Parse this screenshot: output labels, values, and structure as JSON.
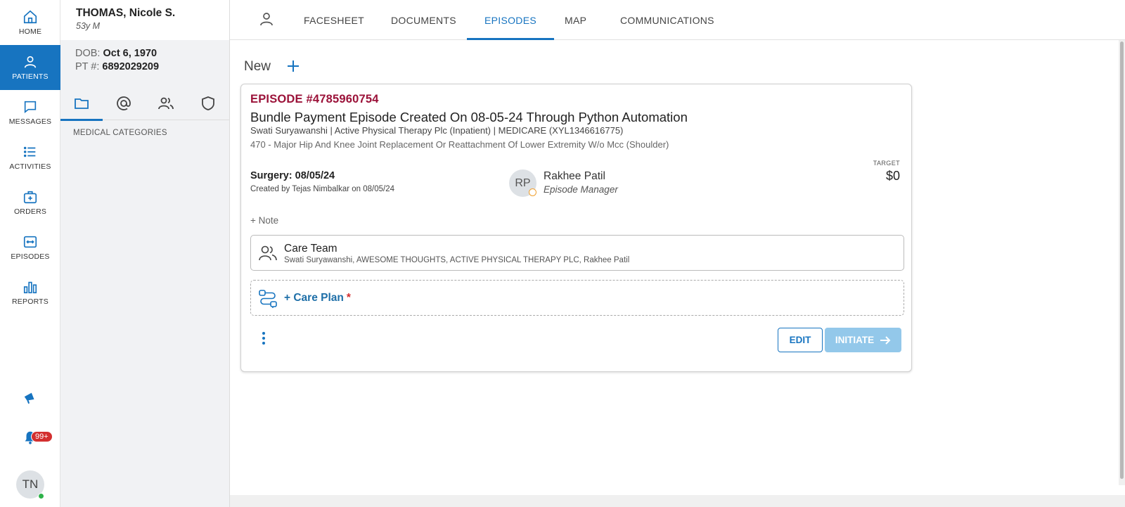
{
  "leftnav": {
    "items": [
      {
        "label": "HOME",
        "icon": "home-icon"
      },
      {
        "label": "PATIENTS",
        "icon": "person-icon"
      },
      {
        "label": "MESSAGES",
        "icon": "chat-icon"
      },
      {
        "label": "ACTIVITIES",
        "icon": "list-icon"
      },
      {
        "label": "ORDERS",
        "icon": "medical-bag-icon"
      },
      {
        "label": "EPISODES",
        "icon": "episode-icon"
      },
      {
        "label": "REPORTS",
        "icon": "bar-chart-icon"
      }
    ],
    "active": "PATIENTS",
    "notification_count": "99+",
    "user_initials": "TN"
  },
  "patient": {
    "name": "THOMAS, Nicole S.",
    "age_sex": "53y M",
    "dob_label": "DOB:",
    "dob": "Oct 6, 1970",
    "pt_label": "PT #:",
    "pt_number": "6892029209",
    "section_label": "MEDICAL CATEGORIES"
  },
  "tabs": [
    "FACESHEET",
    "DOCUMENTS",
    "EPISODES",
    "MAP",
    "COMMUNICATIONS"
  ],
  "active_tab": "EPISODES",
  "main": {
    "new_label": "New",
    "episode": {
      "id": "EPISODE #4785960754",
      "title": "Bundle Payment Episode Created On 08-05-24 Through Python Automation",
      "subtitle": "Swati Suryawanshi | Active Physical Therapy Plc (Inpatient) | MEDICARE (XYL1346616775)",
      "drg": "470 - Major Hip And Knee Joint Replacement Or Reattachment Of Lower Extremity W/o Mcc (Shoulder)",
      "surgery": "Surgery: 08/05/24",
      "created": "Created by Tejas Nimbalkar on 08/05/24",
      "manager_initials": "RP",
      "manager_name": "Rakhee Patil",
      "manager_role": "Episode Manager",
      "target_label": "TARGET",
      "target_value": "$0",
      "note_label": "+ Note",
      "care_team_title": "Care Team",
      "care_team_members": "Swati Suryawanshi, AWESOME THOUGHTS, ACTIVE PHYSICAL THERAPY PLC, Rakhee Patil",
      "care_plan_label": "+ Care Plan",
      "care_plan_required": "*",
      "edit_label": "EDIT",
      "initiate_label": "INITIATE"
    }
  },
  "colors": {
    "accent": "#1774c0",
    "episode_id": "#9b1239",
    "initiate_disabled": "#93c8ea",
    "badge": "#d32f2f"
  }
}
